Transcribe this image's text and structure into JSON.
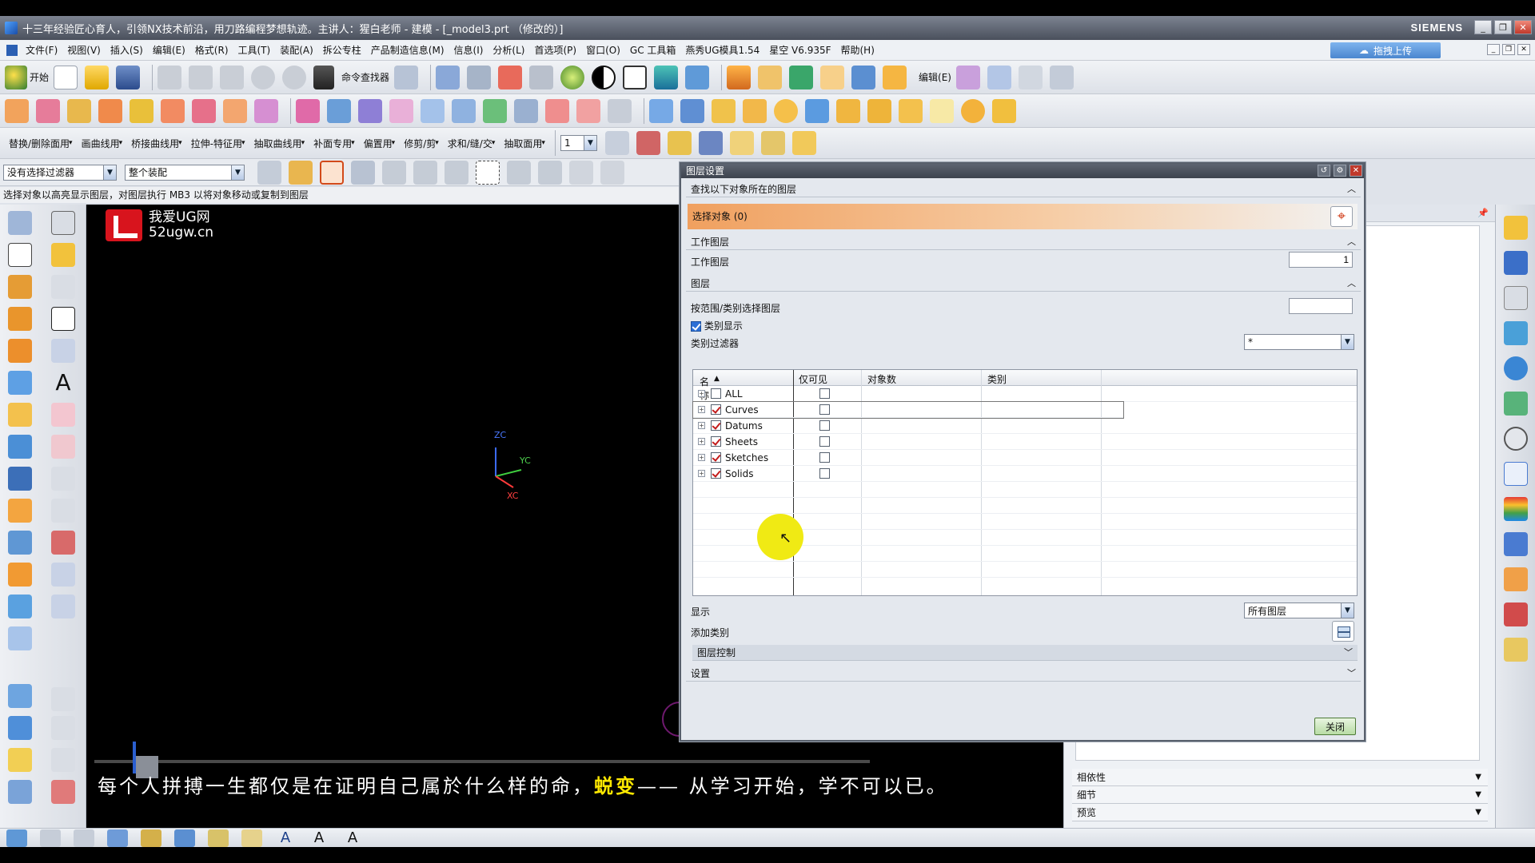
{
  "window": {
    "title": "十三年经验匠心育人，引领NX技术前沿，用刀路编程梦想轨迹。主讲人：猩白老师 - 建模 - [_model3.prt （修改的）]",
    "brand": "SIEMENS",
    "min": "_",
    "restore": "❐",
    "close": "✕"
  },
  "menubar": {
    "items": [
      "文件(F)",
      "视图(V)",
      "插入(S)",
      "编辑(E)",
      "格式(R)",
      "工具(T)",
      "装配(A)",
      "拆公专柱",
      "产品制造信息(M)",
      "信息(I)",
      "分析(L)",
      "首选项(P)",
      "窗口(O)",
      "GC 工具箱",
      "燕秀UG模具1.54",
      "星空 V6.935F",
      "帮助(H)"
    ],
    "cloud_button": "拖拽上传"
  },
  "toolbar1": {
    "start_label": "开始",
    "cmd_finder": "命令查找器",
    "edit_label": "编辑(E)"
  },
  "toolbar3": {
    "labels": [
      "替换/删除面用",
      "画曲线用",
      "桥接曲线用",
      "拉伸-特征用",
      "抽取曲线用",
      "补面专用",
      "偏置用",
      "修剪/剪",
      "求和/缝/交",
      "抽取面用"
    ],
    "layer_value": "1"
  },
  "filterbar": {
    "filter_value": "没有选择过滤器",
    "scope_value": "整个装配"
  },
  "status_text": "选择对象以高亮显示图层，对图层执行 MB3 以将对象移动或复制到图层",
  "viewport": {
    "logo_name": "我爱UG网",
    "logo_url": "52ugw.cn",
    "axis_z": "ZC",
    "axis_y": "YC",
    "axis_x": "XC",
    "subtitle_a": "每个人拼搏一生都仅是在证明自己属於什么样的命，",
    "subtitle_hl": "蜕变",
    "subtitle_b": "—— 从学习开始，学不可以已。"
  },
  "right_panel": {
    "sections": [
      "相依性",
      "细节",
      "预览"
    ]
  },
  "dialog": {
    "title": "图层设置",
    "sec_find": "查找以下对象所在的图层",
    "select_objects": "选择对象 (0)",
    "sec_work": "工作图层",
    "work_layer_label": "工作图层",
    "work_layer_value": "1",
    "sec_layer": "图层",
    "range_label": "按范围/类别选择图层",
    "range_value": "",
    "category_display": "类别显示",
    "category_filter_label": "类别过滤器",
    "category_filter_value": "*",
    "columns": [
      "名称",
      "仅可见",
      "对象数",
      "类别"
    ],
    "rows": [
      {
        "name": "ALL",
        "checked": false,
        "visible_only": false
      },
      {
        "name": "Curves",
        "checked": true,
        "visible_only": false
      },
      {
        "name": "Datums",
        "checked": true,
        "visible_only": false
      },
      {
        "name": "Sheets",
        "checked": true,
        "visible_only": false
      },
      {
        "name": "Sketches",
        "checked": true,
        "visible_only": false
      },
      {
        "name": "Solids",
        "checked": true,
        "visible_only": false
      }
    ],
    "display_label": "显示",
    "display_value": "所有图层",
    "add_category_label": "添加类别",
    "layer_control": "图层控制",
    "settings": "设置",
    "close_button": "关闭"
  },
  "colors": {
    "accent_orange": "#f0a05f",
    "highlight_yellow": "#f0ea14",
    "subtitle_highlight": "#ffe800"
  }
}
